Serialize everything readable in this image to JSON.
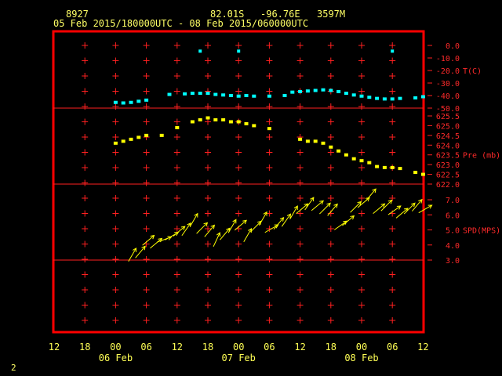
{
  "header": {
    "station": "8927",
    "lat": "82.01S",
    "lon": "-96.76E",
    "elev": "3597M",
    "range": "05 Feb 2015/180000UTC - 08 Feb 2015/060000UTC"
  },
  "page_number": "2",
  "colors": {
    "frame": "#ff0000",
    "grid": "#ff2020",
    "temp": "#00ffff",
    "pres": "#ffff00",
    "wind": "#ffff00",
    "text": "#ffff66"
  },
  "chart_data": [
    {
      "type": "scatter",
      "name": "temperature",
      "ylabel": "T(C)",
      "ylim": [
        -50,
        5
      ],
      "yticks": [
        "0.0",
        "-10.0",
        "-20.0",
        "-30.0",
        "-40.0",
        "-50.0"
      ],
      "x_hours": [
        -6,
        -4.5,
        -3,
        -1.5,
        0,
        4.5,
        7.5,
        9,
        10.5,
        12,
        13.5,
        15,
        16.5,
        18,
        19.5,
        21,
        24,
        27,
        28.5,
        30,
        31.5,
        33,
        34.5,
        36,
        37.5,
        39,
        40.5,
        42,
        43.5,
        45,
        46.5,
        48,
        49.5,
        52.5,
        54
      ],
      "values": [
        -45,
        -45.5,
        -45,
        -44,
        -43,
        -38,
        -37.5,
        -37,
        -37,
        -37,
        -38,
        -38.5,
        -39,
        -39.5,
        -39,
        -39.5,
        -39.5,
        -39,
        -36,
        -35.5,
        -35,
        -34.5,
        -34,
        -34.5,
        -35.5,
        -37,
        -38.5,
        -39.5,
        -40.5,
        -41.5,
        -42,
        -42,
        -41.5,
        -41,
        -40
      ],
      "outliers": {
        "x_hours": [
          10.5,
          18,
          48
        ],
        "values": [
          0,
          0,
          0
        ]
      }
    },
    {
      "type": "scatter",
      "name": "pressure",
      "ylabel": "Pre (mb)",
      "ylim": [
        622.0,
        625.5
      ],
      "yticks": [
        "625.5",
        "625.0",
        "624.5",
        "624.0",
        "623.5",
        "623.0",
        "622.5",
        "622.0"
      ],
      "x_hours": [
        -6,
        -4.5,
        -3,
        -1.5,
        0,
        3,
        6,
        9,
        10.5,
        12,
        13.5,
        15,
        16.5,
        18,
        19.5,
        21,
        24,
        30,
        31.5,
        33,
        34.5,
        36,
        37.5,
        39,
        40.5,
        42,
        43.5,
        45,
        46.5,
        48,
        49.5,
        52.5,
        54
      ],
      "values": [
        624.1,
        624.2,
        624.3,
        624.4,
        624.5,
        624.5,
        624.9,
        625.2,
        625.3,
        625.4,
        625.3,
        625.3,
        625.2,
        625.2,
        625.1,
        625.0,
        624.85,
        624.3,
        624.2,
        624.2,
        624.1,
        623.9,
        623.7,
        623.5,
        623.3,
        623.2,
        623.1,
        622.9,
        622.85,
        622.85,
        622.8,
        622.6,
        622.5
      ]
    },
    {
      "type": "scatter",
      "name": "wind",
      "ylabel": "SPD(MPS)",
      "ylim": [
        3.0,
        7.0
      ],
      "yticks": [
        "7.0",
        "6.0",
        "5.0",
        "4.0",
        "3.0"
      ],
      "x_hours": [
        -3,
        -1.5,
        0,
        1.5,
        3,
        4.5,
        6,
        7.5,
        9,
        10.5,
        12,
        13.5,
        15,
        16.5,
        18,
        19.5,
        21,
        22.5,
        24,
        25.5,
        27,
        28.5,
        30,
        31.5,
        33,
        34.5,
        36,
        37.5,
        39,
        40.5,
        42,
        43.5,
        45,
        46.5,
        48,
        49.5,
        51,
        52.5,
        54
      ],
      "values": [
        3.2,
        3.4,
        4.2,
        4.0,
        4.3,
        4.5,
        4.8,
        4.9,
        5.5,
        5.0,
        4.8,
        4.2,
        4.6,
        5.1,
        5.2,
        4.5,
        5.1,
        5.6,
        5.0,
        5.3,
        5.5,
        6.0,
        6.3,
        6.6,
        6.5,
        6.3,
        6.2,
        5.2,
        5.5,
        6.4,
        6.7,
        7.2,
        6.3,
        6.5,
        6.2,
        6.0,
        6.3,
        6.5,
        6.3
      ],
      "direction_deg": [
        210,
        220,
        230,
        230,
        250,
        240,
        230,
        215,
        210,
        225,
        220,
        205,
        220,
        210,
        230,
        210,
        225,
        210,
        240,
        220,
        215,
        210,
        230,
        215,
        230,
        225,
        220,
        235,
        230,
        225,
        230,
        220,
        230,
        225,
        235,
        230,
        225,
        220,
        240
      ]
    }
  ],
  "x_axis": {
    "ticks": [
      "12",
      "18",
      "00",
      "06",
      "12",
      "18",
      "00",
      "06",
      "12",
      "18",
      "00",
      "06",
      "12"
    ],
    "day_labels": [
      {
        "text": "06 Feb",
        "tick_index": 2
      },
      {
        "text": "07 Feb",
        "tick_index": 6
      },
      {
        "text": "08 Feb",
        "tick_index": 10
      }
    ]
  }
}
